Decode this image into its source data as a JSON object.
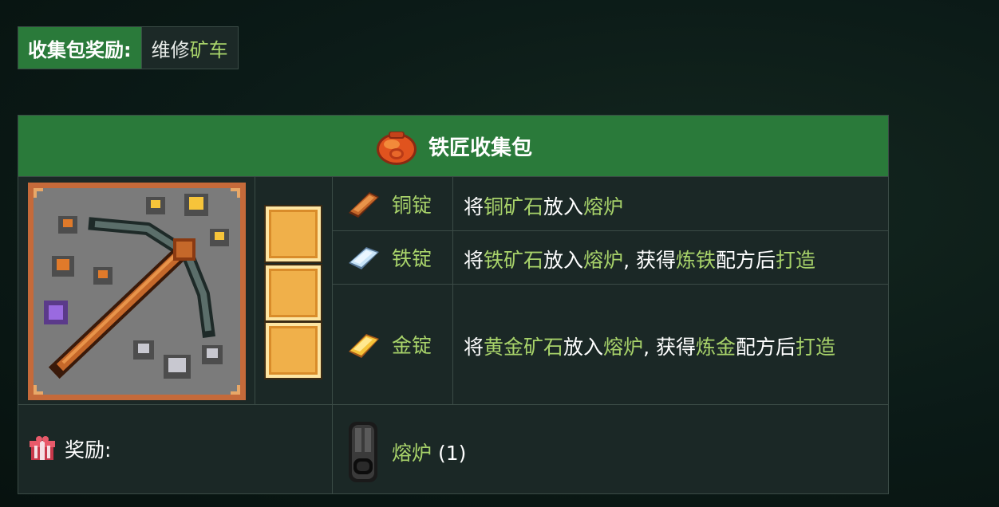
{
  "bundle_reward": {
    "label": "收集包奖励:",
    "value_prefix": "维修",
    "value_highlight": "矿车"
  },
  "bundle": {
    "title": "铁匠收集包",
    "icon": "orange-sack-icon",
    "art": "pickaxe-with-ores-art",
    "slots_filled": 0,
    "slots_total": 3,
    "items": [
      {
        "name": "铜锭",
        "icon": "copper-bar-icon",
        "desc": [
          {
            "t": "将",
            "hl": false
          },
          {
            "t": "铜矿石",
            "hl": true
          },
          {
            "t": "放入",
            "hl": false
          },
          {
            "t": "熔炉",
            "hl": true
          }
        ]
      },
      {
        "name": "铁锭",
        "icon": "iron-bar-icon",
        "desc": [
          {
            "t": "将",
            "hl": false
          },
          {
            "t": "铁矿石",
            "hl": true
          },
          {
            "t": "放入",
            "hl": false
          },
          {
            "t": "熔炉",
            "hl": true
          },
          {
            "t": ", 获得",
            "hl": false
          },
          {
            "t": "炼铁",
            "hl": true
          },
          {
            "t": "配方后",
            "hl": false
          },
          {
            "t": "打造",
            "hl": true
          }
        ]
      },
      {
        "name": "金锭",
        "icon": "gold-bar-icon",
        "desc": [
          {
            "t": "将",
            "hl": false
          },
          {
            "t": "黄金矿石",
            "hl": true
          },
          {
            "t": "放入",
            "hl": false
          },
          {
            "t": "熔炉",
            "hl": true
          },
          {
            "t": ", 获得",
            "hl": false
          },
          {
            "t": "炼金",
            "hl": true
          },
          {
            "t": "配方后",
            "hl": false
          },
          {
            "t": "打造",
            "hl": true
          }
        ]
      }
    ],
    "reward_label": "奖励:",
    "reward_icon": "gift-box-icon",
    "reward_item": {
      "name": "熔炉",
      "qty": "(1)",
      "icon": "furnace-icon"
    }
  },
  "colors": {
    "highlight": "#a8d36a",
    "header_green": "#2a7a3a",
    "panel_bg": "#1b2826",
    "slot_fill": "#f0b04a"
  }
}
